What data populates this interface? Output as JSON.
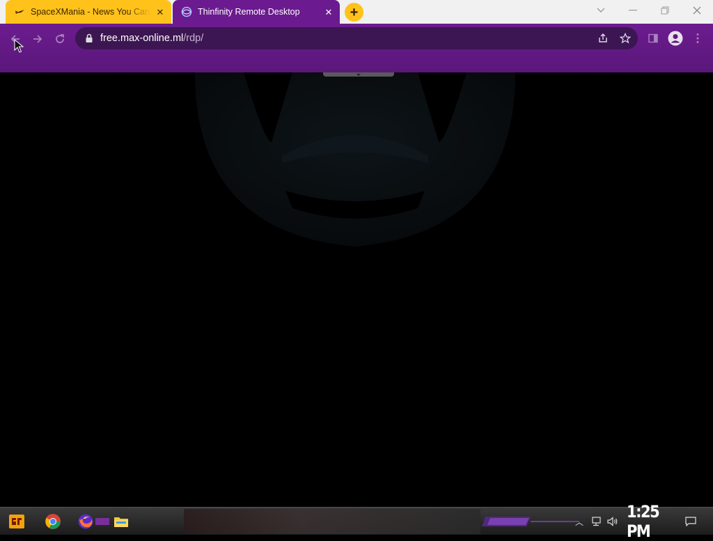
{
  "browser": {
    "tabs": [
      {
        "title": "SpaceXMania - News You Can Trust",
        "active": false,
        "favicon": "spacex-icon"
      },
      {
        "title": "Thinfinity Remote Desktop",
        "active": true,
        "favicon": "thinfinity-icon"
      }
    ],
    "new_tab_icon": "plus-icon",
    "address_bar": {
      "host": "free.max-online.ml",
      "path": "/rdp/"
    },
    "theme": {
      "accent": "#6b1a8f",
      "tab_inactive": "#ffc21a",
      "omnibox": "#3c1652"
    }
  },
  "taskbar": {
    "pinned": [
      "start-logo-icon",
      "chrome-icon",
      "firefox-icon",
      "file-explorer-icon"
    ],
    "clock": "1:25 PM",
    "tray": [
      "show-hidden-icons-chevron",
      "network-icon",
      "volume-icon",
      "action-center-icon"
    ]
  }
}
